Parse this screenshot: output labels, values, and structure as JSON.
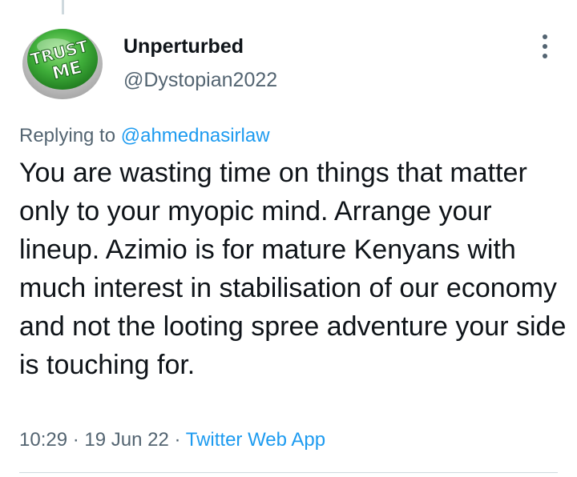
{
  "author": {
    "display_name": "Unperturbed",
    "handle": "@Dystopian2022",
    "avatar_text_top": "TRUST",
    "avatar_text_bottom": "ME",
    "avatar_colors": {
      "button": "#3fae3a",
      "button_dark": "#1f7a1f",
      "ring": "#c9c9c9"
    }
  },
  "reply": {
    "prefix": "Replying to",
    "mention": "@ahmednasirlaw"
  },
  "tweet": {
    "text": "You are wasting time on things that matter only to your myopic mind. Arrange your lineup. Azimio is for mature Kenyans with much interest in stabilisation of our economy and not the looting spree adventure your side is touching for."
  },
  "meta": {
    "time": "10:29",
    "separator": "·",
    "date": "19 Jun 22",
    "app": "Twitter Web App"
  },
  "icons": {
    "more": "more-vertical-icon"
  },
  "colors": {
    "text": "#0f1419",
    "secondary": "#536471",
    "link": "#1d9bf0",
    "divider": "#cfd9de"
  }
}
